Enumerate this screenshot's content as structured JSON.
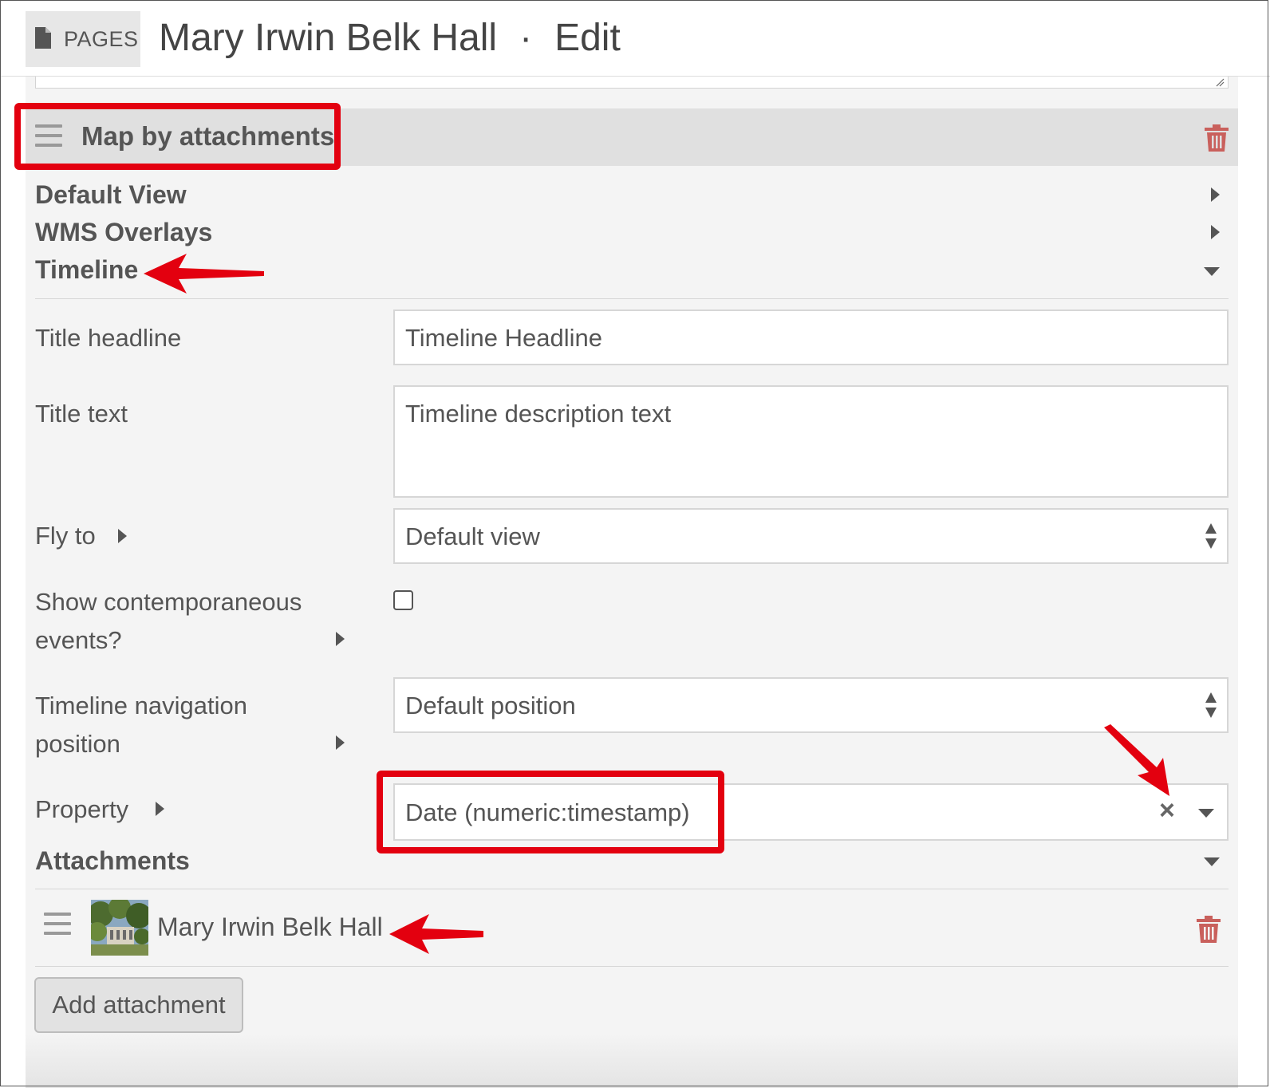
{
  "header": {
    "section_label": "PAGES",
    "page_name": "Mary Irwin Belk Hall",
    "separator": "·",
    "mode": "Edit"
  },
  "block": {
    "title": "Map by attachments"
  },
  "sections": {
    "default_view": "Default View",
    "wms_overlays": "WMS Overlays",
    "timeline": "Timeline",
    "attachments": "Attachments"
  },
  "timeline": {
    "title_headline": {
      "label": "Title headline",
      "value": "Timeline Headline"
    },
    "title_text": {
      "label": "Title text",
      "value": "Timeline description text"
    },
    "fly_to": {
      "label": "Fly to",
      "value": "Default view"
    },
    "contemporaneous": {
      "label_line1": "Show contemporaneous",
      "label_line2": "events?",
      "checked": false
    },
    "nav_position": {
      "label_line1": "Timeline navigation",
      "label_line2": "position",
      "value": "Default position"
    },
    "property": {
      "label": "Property",
      "value": "Date (numeric:timestamp)",
      "clear_glyph": "×"
    }
  },
  "attachments": [
    {
      "name": "Mary Irwin Belk Hall"
    }
  ],
  "add_attachment_label": "Add attachment",
  "colors": {
    "annotation_red": "#e3000f",
    "trash_red": "#c9605c",
    "panel_bg": "#f4f4f4",
    "header_bar_bg": "#e0e0e0"
  }
}
